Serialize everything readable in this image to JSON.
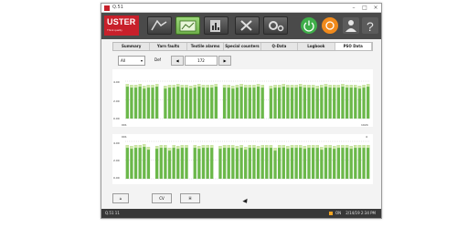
{
  "window": {
    "title": "Q.51"
  },
  "logo": {
    "text": "USTER",
    "sub": "Think quality"
  },
  "toolbar": {
    "buttons": [
      "analysis-icon",
      "data-icon",
      "report-icon",
      "tools-icon",
      "settings-icon"
    ],
    "round_buttons": [
      {
        "name": "power-icon",
        "color": "#3fae49"
      },
      {
        "name": "alarm-icon",
        "color": "#f08a1c"
      },
      {
        "name": "user-icon",
        "color": "#5b5b5b"
      },
      {
        "name": "help-icon",
        "color": "#5b5b5b"
      }
    ]
  },
  "tabs": [
    {
      "label": "Summary",
      "active": false
    },
    {
      "label": "Yarn faults",
      "active": false
    },
    {
      "label": "Textile alarms",
      "active": false
    },
    {
      "label": "Special counters",
      "active": false
    },
    {
      "label": "Q-Data",
      "active": false
    },
    {
      "label": "Logbook",
      "active": false
    },
    {
      "label": "PSO Data",
      "active": true
    }
  ],
  "controls": {
    "select_value": "All",
    "label": "Def",
    "range_value": "172",
    "prev_glyph": "◀",
    "next_glyph": "▶"
  },
  "chart_top": {
    "y_ticks": [
      "4.00",
      "2.00",
      "0.00"
    ],
    "x_left": "001",
    "x_right": "1024"
  },
  "chart_bottom": {
    "top_left": "001",
    "top_right": "4",
    "y_ticks": [
      "4.00",
      "2.00",
      "0.00"
    ]
  },
  "bottom_buttons": {
    "home_glyph": "⌂",
    "btn1": "CV",
    "btn2": "H"
  },
  "status": {
    "left": "Q.51 11",
    "indicator": "ON",
    "right_text": "2/14/19 2:34 PM"
  },
  "colors": {
    "bar_green": "#6bb84a",
    "bar_light": "#cfe8a8",
    "accent_red": "#c8202b"
  },
  "chart_data": [
    {
      "type": "bar",
      "ylim": [
        0,
        4.0
      ],
      "values": [
        3.7,
        3.6,
        3.6,
        3.7,
        3.5,
        3.6,
        3.6,
        3.7,
        3.6,
        3.5,
        3.6,
        3.6,
        3.7,
        3.6,
        3.6,
        3.5,
        3.6,
        3.7,
        3.6,
        3.6,
        3.6,
        3.7,
        3.6,
        3.6,
        3.6,
        3.5,
        3.6,
        3.7,
        3.6,
        3.6,
        3.6,
        3.7,
        3.6,
        3.6,
        3.5,
        3.6,
        3.6,
        3.7,
        3.6,
        3.6,
        3.6,
        3.7,
        3.6,
        3.6,
        3.6,
        3.5,
        3.6,
        3.7,
        3.6,
        3.6,
        3.6,
        3.7,
        3.6,
        3.6,
        3.6,
        3.5,
        3.6,
        3.7
      ],
      "gaps": [
        8,
        22,
        33
      ]
    },
    {
      "type": "bar",
      "ylim": [
        0,
        4.0
      ],
      "values": [
        3.6,
        3.5,
        3.6,
        3.6,
        3.7,
        3.4,
        3.6,
        3.5,
        3.6,
        3.6,
        3.3,
        3.6,
        3.5,
        3.6,
        3.6,
        3.2,
        3.6,
        3.5,
        3.6,
        3.6,
        3.6,
        3.4,
        3.5,
        3.6,
        3.6,
        3.6,
        3.5,
        3.6,
        3.4,
        3.6,
        3.6,
        3.5,
        3.6,
        3.6,
        3.6,
        3.3,
        3.6,
        3.6,
        3.5,
        3.6,
        3.6,
        3.6,
        3.5,
        3.6,
        3.6,
        3.6,
        3.4,
        3.6,
        3.6,
        3.5,
        3.6,
        3.6,
        3.6,
        3.5,
        3.6,
        3.6,
        3.6,
        3.6
      ],
      "gaps": [
        6,
        15,
        21
      ]
    }
  ]
}
